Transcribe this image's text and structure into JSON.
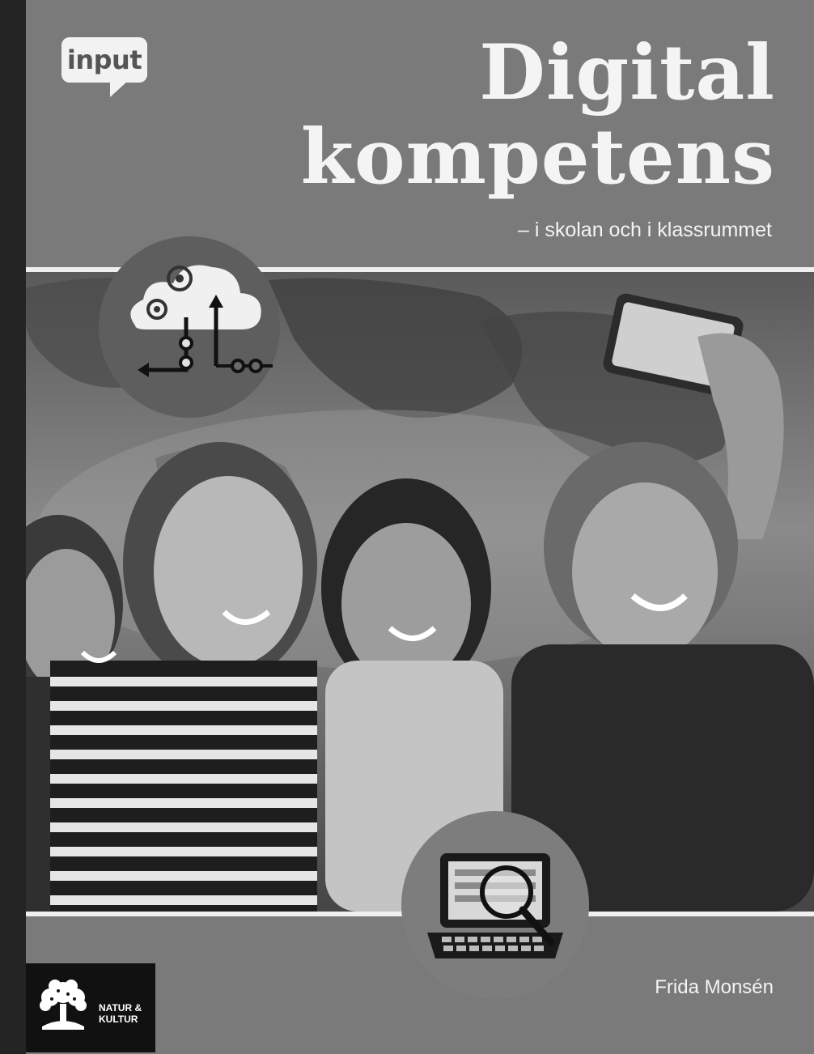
{
  "series": {
    "label": "input"
  },
  "title": {
    "line1": "Digital",
    "line2": "kompetens"
  },
  "subtitle": "– i skolan och i klassrummet",
  "author": "Frida Monsén",
  "publisher": {
    "line1": "NATUR &",
    "line2": "KULTUR"
  },
  "icons": {
    "cloud": "cloud-network-icon",
    "laptop": "laptop-search-icon",
    "publisher": "tree-logo-icon"
  },
  "colors": {
    "background": "#7a7a7a",
    "text": "#f4f4f4",
    "spine": "#242424"
  }
}
